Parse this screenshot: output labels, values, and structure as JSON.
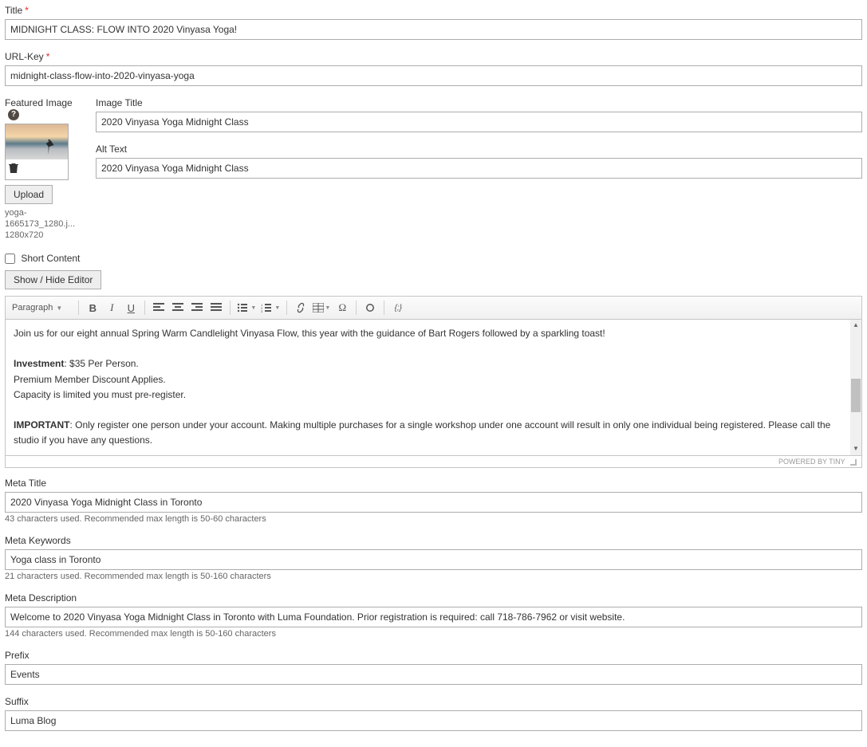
{
  "title": {
    "label": "Title",
    "value": "MIDNIGHT CLASS: FLOW INTO 2020 Vinyasa Yoga!"
  },
  "url_key": {
    "label": "URL-Key",
    "value": "midnight-class-flow-into-2020-vinyasa-yoga"
  },
  "featured_image": {
    "label": "Featured Image",
    "upload_label": "Upload",
    "filename": "yoga-1665173_1280.j...",
    "dimensions": "1280x720"
  },
  "image_title": {
    "label": "Image Title",
    "value": "2020 Vinyasa Yoga Midnight Class"
  },
  "alt_text": {
    "label": "Alt Text",
    "value": "2020 Vinyasa Yoga Midnight Class"
  },
  "short_content": {
    "label": "Short Content"
  },
  "toggle_editor": {
    "label": "Show / Hide Editor"
  },
  "editor": {
    "format_dropdown": "Paragraph",
    "omega": "Ω",
    "anchor": "⚓",
    "code": "{;}",
    "line1": "Join us for our eight annual Spring Warm Candlelight Vinyasa Flow, this year with the guidance of Bart Rogers followed by a sparkling toast!",
    "invest_label": "Investment",
    "invest_rest": ": $35 Per Person.",
    "line3": "Premium Member Discount Applies.",
    "line4": "Capacity is limited you must pre-register.",
    "important_label": "IMPORTANT",
    "important_rest": ": Only register one person under your account. Making multiple purchases for a single workshop under one account will result in only one individual being registered. Please call the studio if you have any questions.",
    "powered_by": "POWERED BY TINY"
  },
  "meta_title": {
    "label": "Meta Title",
    "value": "2020 Vinyasa Yoga Midnight Class in Toronto",
    "hint": "43 characters used. Recommended max length is 50-60 characters"
  },
  "meta_keywords": {
    "label": "Meta Keywords",
    "value": "Yoga class in Toronto",
    "hint": "21 characters used. Recommended max length is 50-160 characters"
  },
  "meta_description": {
    "label": "Meta Description",
    "value": "Welcome to 2020 Vinyasa Yoga Midnight Class in Toronto with Luma Foundation. Prior registration is required: call 718-786-7962 or visit website.",
    "hint": "144 characters used. Recommended max length is 50-160 characters"
  },
  "prefix": {
    "label": "Prefix",
    "value": "Events"
  },
  "suffix": {
    "label": "Suffix",
    "value": "Luma Blog"
  }
}
